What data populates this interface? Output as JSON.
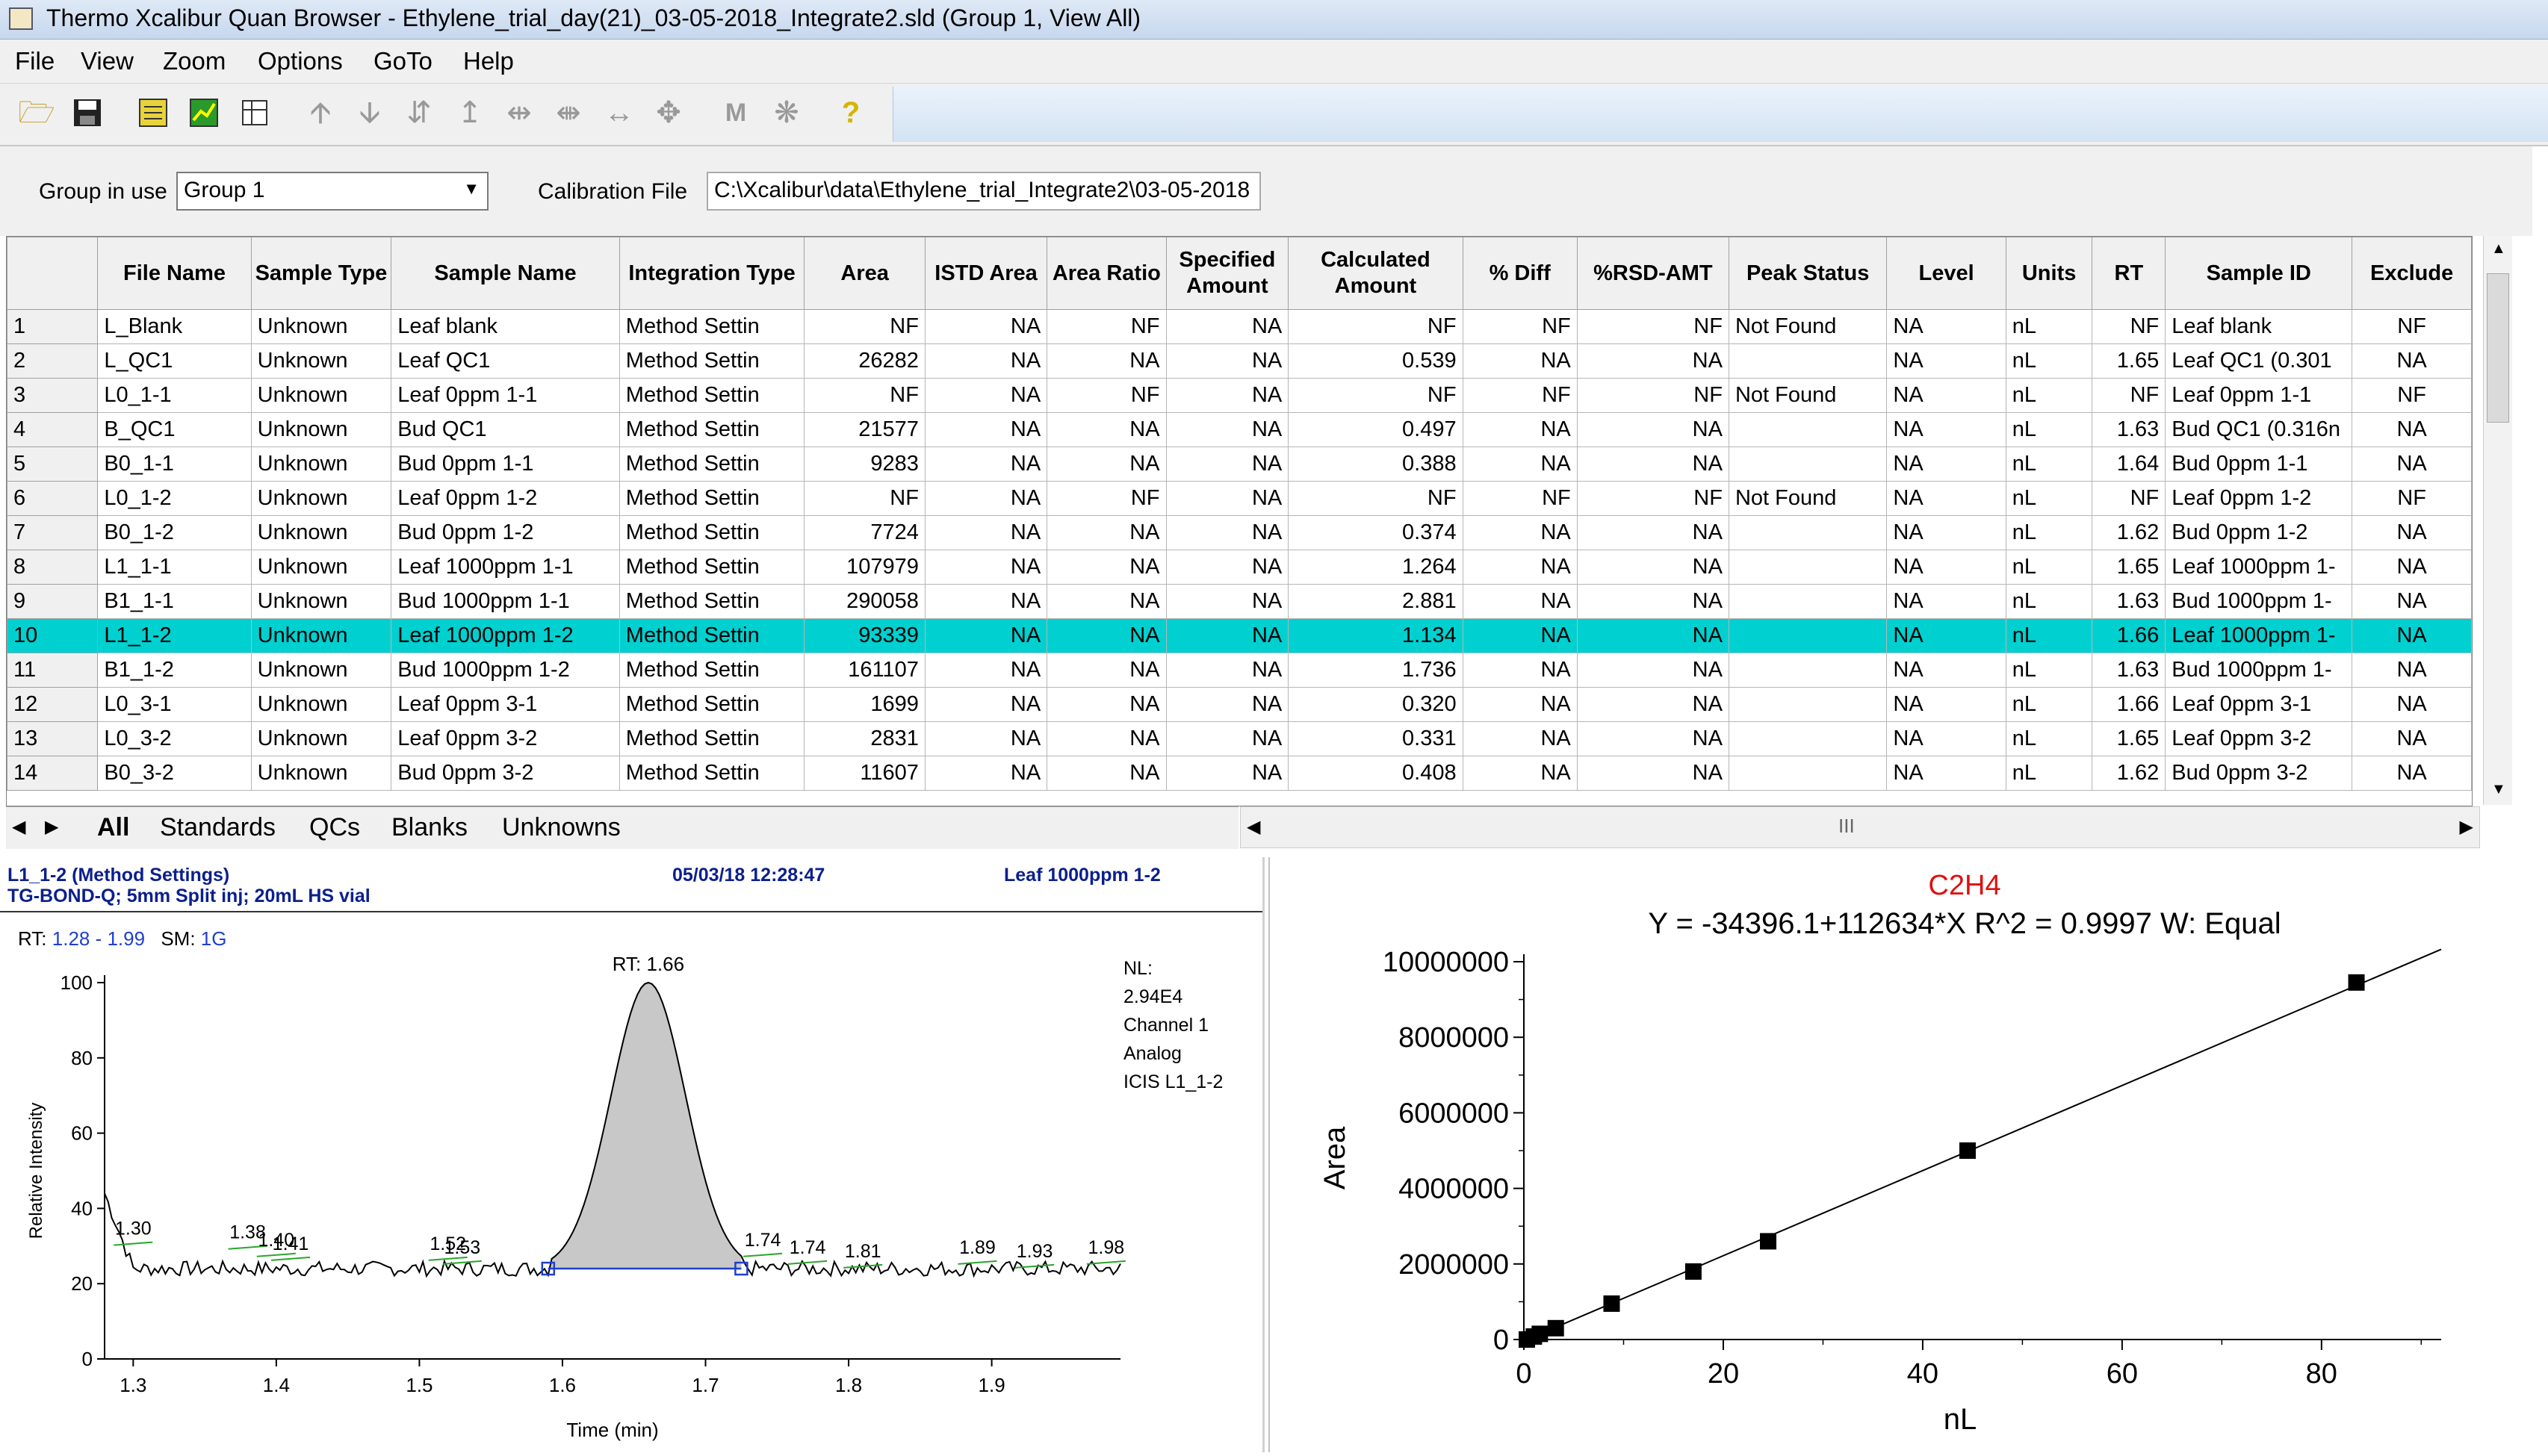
{
  "window": {
    "title": "Thermo Xcalibur Quan Browser - Ethylene_trial_day(21)_03-05-2018_Integrate2.sld (Group 1, View All)"
  },
  "menu": [
    "File",
    "View",
    "Zoom",
    "Options",
    "GoTo",
    "Help"
  ],
  "toolbar": {
    "icons": [
      "open-folder-icon",
      "save-icon",
      "report-icon",
      "chart-icon",
      "sheet-icon",
      "arrow-up-icon",
      "arrow-down-icon",
      "arrow-updown-icon",
      "peak-up-icon",
      "peak-split-icon",
      "peak-join-icon",
      "double-arrow-icon",
      "move-icon",
      "manual-m-icon",
      "manual-run-icon",
      "help-icon"
    ]
  },
  "group": {
    "label": "Group in use",
    "value": "Group 1",
    "calibration_label": "Calibration File",
    "calibration_value": "C:\\Xcalibur\\data\\Ethylene_trial_Integrate2\\03-05-2018"
  },
  "table": {
    "columns": [
      "",
      "File Name",
      "Sample Type",
      "Sample Name",
      "Integration Type",
      "Area",
      "ISTD Area",
      "Area Ratio",
      "Specified Amount",
      "Calculated Amount",
      "% Diff",
      "%RSD-AMT",
      "Peak Status",
      "Level",
      "Units",
      "RT",
      "Sample ID",
      "Exclude"
    ],
    "selected_row": 10,
    "rows": [
      [
        "1",
        "L_Blank",
        "Unknown",
        "Leaf blank",
        "Method Settin",
        "NF",
        "NA",
        "NF",
        "NA",
        "NF",
        "NF",
        "NF",
        "Not Found",
        "NA",
        "nL",
        "NF",
        "Leaf blank",
        "NF"
      ],
      [
        "2",
        "L_QC1",
        "Unknown",
        "Leaf QC1",
        "Method Settin",
        "26282",
        "NA",
        "NA",
        "NA",
        "0.539",
        "NA",
        "NA",
        "",
        "NA",
        "nL",
        "1.65",
        "Leaf QC1 (0.301",
        "NA"
      ],
      [
        "3",
        "L0_1-1",
        "Unknown",
        "Leaf 0ppm  1-1",
        "Method Settin",
        "NF",
        "NA",
        "NF",
        "NA",
        "NF",
        "NF",
        "NF",
        "Not Found",
        "NA",
        "nL",
        "NF",
        "Leaf 0ppm  1-1",
        "NF"
      ],
      [
        "4",
        "B_QC1",
        "Unknown",
        "Bud QC1",
        "Method Settin",
        "21577",
        "NA",
        "NA",
        "NA",
        "0.497",
        "NA",
        "NA",
        "",
        "NA",
        "nL",
        "1.63",
        "Bud QC1 (0.316n",
        "NA"
      ],
      [
        "5",
        "B0_1-1",
        "Unknown",
        "Bud 0ppm 1-1",
        "Method Settin",
        "9283",
        "NA",
        "NA",
        "NA",
        "0.388",
        "NA",
        "NA",
        "",
        "NA",
        "nL",
        "1.64",
        "Bud 0ppm 1-1",
        "NA"
      ],
      [
        "6",
        "L0_1-2",
        "Unknown",
        "Leaf 0ppm  1-2",
        "Method Settin",
        "NF",
        "NA",
        "NF",
        "NA",
        "NF",
        "NF",
        "NF",
        "Not Found",
        "NA",
        "nL",
        "NF",
        "Leaf 0ppm  1-2",
        "NF"
      ],
      [
        "7",
        "B0_1-2",
        "Unknown",
        "Bud 0ppm 1-2",
        "Method Settin",
        "7724",
        "NA",
        "NA",
        "NA",
        "0.374",
        "NA",
        "NA",
        "",
        "NA",
        "nL",
        "1.62",
        "Bud 0ppm 1-2",
        "NA"
      ],
      [
        "8",
        "L1_1-1",
        "Unknown",
        "Leaf 1000ppm 1-1",
        "Method Settin",
        "107979",
        "NA",
        "NA",
        "NA",
        "1.264",
        "NA",
        "NA",
        "",
        "NA",
        "nL",
        "1.65",
        "Leaf 1000ppm 1-",
        "NA"
      ],
      [
        "9",
        "B1_1-1",
        "Unknown",
        "Bud 1000ppm 1-1",
        "Method Settin",
        "290058",
        "NA",
        "NA",
        "NA",
        "2.881",
        "NA",
        "NA",
        "",
        "NA",
        "nL",
        "1.63",
        "Bud 1000ppm 1-",
        "NA"
      ],
      [
        "10",
        "L1_1-2",
        "Unknown",
        "Leaf 1000ppm 1-2",
        "Method Settin",
        "93339",
        "NA",
        "NA",
        "NA",
        "1.134",
        "NA",
        "NA",
        "",
        "NA",
        "nL",
        "1.66",
        "Leaf 1000ppm 1-",
        "NA"
      ],
      [
        "11",
        "B1_1-2",
        "Unknown",
        "Bud 1000ppm 1-2",
        "Method Settin",
        "161107",
        "NA",
        "NA",
        "NA",
        "1.736",
        "NA",
        "NA",
        "",
        "NA",
        "nL",
        "1.63",
        "Bud 1000ppm 1-",
        "NA"
      ],
      [
        "12",
        "L0_3-1",
        "Unknown",
        "Leaf 0ppm  3-1",
        "Method Settin",
        "1699",
        "NA",
        "NA",
        "NA",
        "0.320",
        "NA",
        "NA",
        "",
        "NA",
        "nL",
        "1.66",
        "Leaf 0ppm  3-1",
        "NA"
      ],
      [
        "13",
        "L0_3-2",
        "Unknown",
        "Leaf 0ppm  3-2",
        "Method Settin",
        "2831",
        "NA",
        "NA",
        "NA",
        "0.331",
        "NA",
        "NA",
        "",
        "NA",
        "nL",
        "1.65",
        "Leaf 0ppm  3-2",
        "NA"
      ],
      [
        "14",
        "B0_3-2",
        "Unknown",
        "Bud 0ppm 3-2",
        "Method Settin",
        "11607",
        "NA",
        "NA",
        "NA",
        "0.408",
        "NA",
        "NA",
        "",
        "NA",
        "nL",
        "1.62",
        "Bud 0ppm 3-2",
        "NA"
      ]
    ]
  },
  "tabs": [
    "All",
    "Standards",
    "QCs",
    "Blanks",
    "Unknowns"
  ],
  "hscroll_grip": "III",
  "chromatogram": {
    "header_left": "L1_1-2  (Method Settings)",
    "header_date": "05/03/18 12:28:47",
    "header_right": "Leaf 1000ppm 1-2",
    "subheader": "TG-BOND-Q; 5mm Split inj; 20mL HS vial",
    "rt_label": "RT:",
    "rt_range": "1.28 - 1.99",
    "sm_label": "SM:",
    "sm_value": "1G",
    "nl_lines": [
      "NL:",
      "2.94E4",
      "Channel 1",
      "Analog",
      "ICIS L1_1-2"
    ],
    "peak_label": "RT: 1.66",
    "xlabel": "Time (min)",
    "ylabel": "Relative Intensity",
    "xticks": [
      1.3,
      1.4,
      1.5,
      1.6,
      1.7,
      1.8,
      1.9
    ],
    "xtick_labels": [
      "1.3",
      "1.4",
      "1.5",
      "1.6",
      "1.7",
      "1.8",
      "1.9"
    ],
    "yticks": [
      0,
      20,
      40,
      60,
      80,
      100
    ],
    "ytick_labels": [
      "0",
      "20",
      "40",
      "60",
      "80",
      "100"
    ],
    "xlim": [
      1.28,
      1.99
    ],
    "ylim": [
      0,
      100
    ],
    "peak": {
      "rt": 1.66,
      "start": 1.59,
      "end": 1.725,
      "baseline": 24,
      "apex": 100
    },
    "annotations": [
      {
        "x": 1.3,
        "y": 33,
        "label": "1.30"
      },
      {
        "x": 1.38,
        "y": 32,
        "label": "1.38"
      },
      {
        "x": 1.4,
        "y": 30,
        "label": "1.40"
      },
      {
        "x": 1.41,
        "y": 29,
        "label": "1.41"
      },
      {
        "x": 1.52,
        "y": 29,
        "label": "1.52"
      },
      {
        "x": 1.53,
        "y": 28,
        "label": "1.53"
      },
      {
        "x": 1.74,
        "y": 30,
        "label": "1.74"
      },
      {
        "x": 1.74,
        "y": 28,
        "label": "1.74"
      },
      {
        "x": 1.81,
        "y": 27,
        "label": "1.81"
      },
      {
        "x": 1.89,
        "y": 28,
        "label": "1.89"
      },
      {
        "x": 1.93,
        "y": 27,
        "label": "1.93"
      },
      {
        "x": 1.98,
        "y": 28,
        "label": "1.98"
      }
    ]
  },
  "chart_data": {
    "type": "scatter",
    "title": "C2H4",
    "subtitle": "Y = -34396.1+112634*X   R^2 = 0.9997   W: Equal",
    "xlabel": "nL",
    "ylabel": "Area",
    "xlim": [
      0,
      92
    ],
    "ylim": [
      0,
      10000000
    ],
    "xticks": [
      0,
      20,
      40,
      60,
      80
    ],
    "xtick_labels": [
      "0",
      "20",
      "40",
      "60",
      "80"
    ],
    "yticks": [
      0,
      2000000,
      4000000,
      6000000,
      8000000,
      10000000
    ],
    "ytick_labels": [
      "0",
      "2000000",
      "4000000",
      "6000000",
      "8000000",
      "10000000"
    ],
    "points": [
      {
        "x": 0.3,
        "y": 0
      },
      {
        "x": 1.0,
        "y": 80000
      },
      {
        "x": 1.6,
        "y": 150000
      },
      {
        "x": 3.2,
        "y": 300000
      },
      {
        "x": 8.8,
        "y": 950000
      },
      {
        "x": 17,
        "y": 1800000
      },
      {
        "x": 24.5,
        "y": 2600000
      },
      {
        "x": 44.5,
        "y": 5000000
      },
      {
        "x": 83.5,
        "y": 9450000
      }
    ],
    "fit": {
      "intercept": -34396.1,
      "slope": 112634,
      "x_end": 92
    }
  }
}
